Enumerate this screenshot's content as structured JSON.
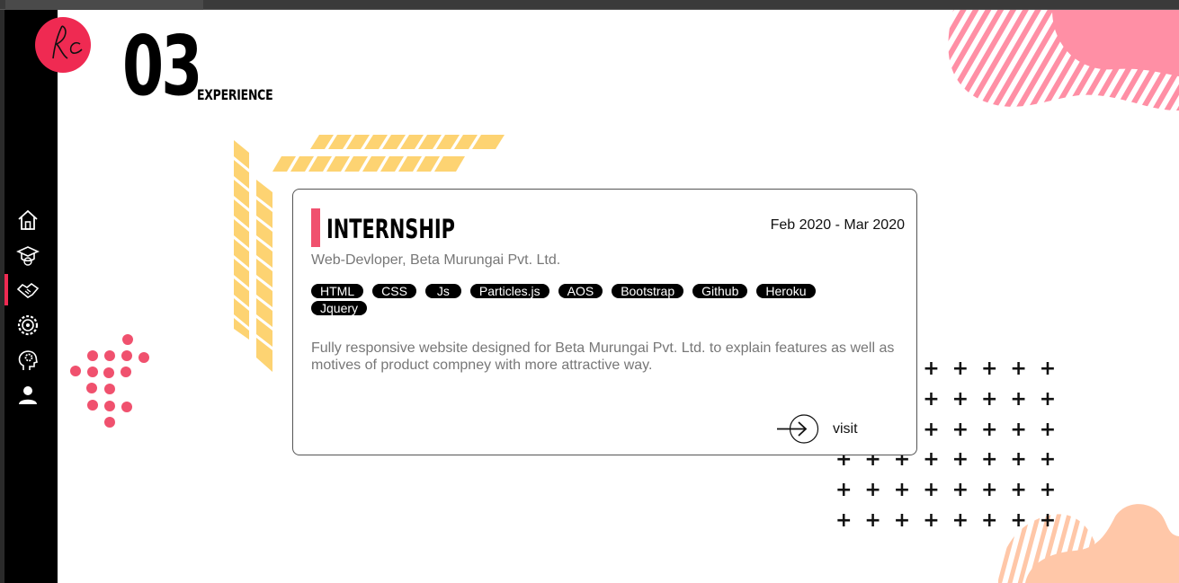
{
  "section": {
    "number": "03",
    "title": "EXPERIENCE"
  },
  "logo": {
    "text": "Rc",
    "color": "#ef2a52"
  },
  "nav": {
    "items": [
      {
        "name": "home",
        "icon": "home-icon",
        "active": false
      },
      {
        "name": "education",
        "icon": "graduation-cap-icon",
        "active": false
      },
      {
        "name": "experience",
        "icon": "handshake-icon",
        "active": true
      },
      {
        "name": "skills",
        "icon": "gear-badge-icon",
        "active": false
      },
      {
        "name": "thinking",
        "icon": "brain-gear-icon",
        "active": false
      },
      {
        "name": "contact",
        "icon": "user-icon",
        "active": false
      }
    ]
  },
  "experience": {
    "role": "INTERNSHIP",
    "date": "Feb 2020 - Mar 2020",
    "company": "Web-Devloper, Beta Murungai Pvt. Ltd.",
    "tags": [
      "HTML",
      "CSS",
      "Js",
      "Particles.js",
      "AOS",
      "Bootstrap",
      "Github",
      "Heroku",
      "Jquery"
    ],
    "description": "Fully responsive website designed for Beta Murungai Pvt. Ltd. to explain features as well as motives of product compney with more attractive way.",
    "visit_label": "visit"
  },
  "colors": {
    "accent": "#f0516e",
    "wheat": "#fdd372",
    "blob_pink": "#ff8fa5",
    "blob_peach": "#ffc7a8"
  }
}
